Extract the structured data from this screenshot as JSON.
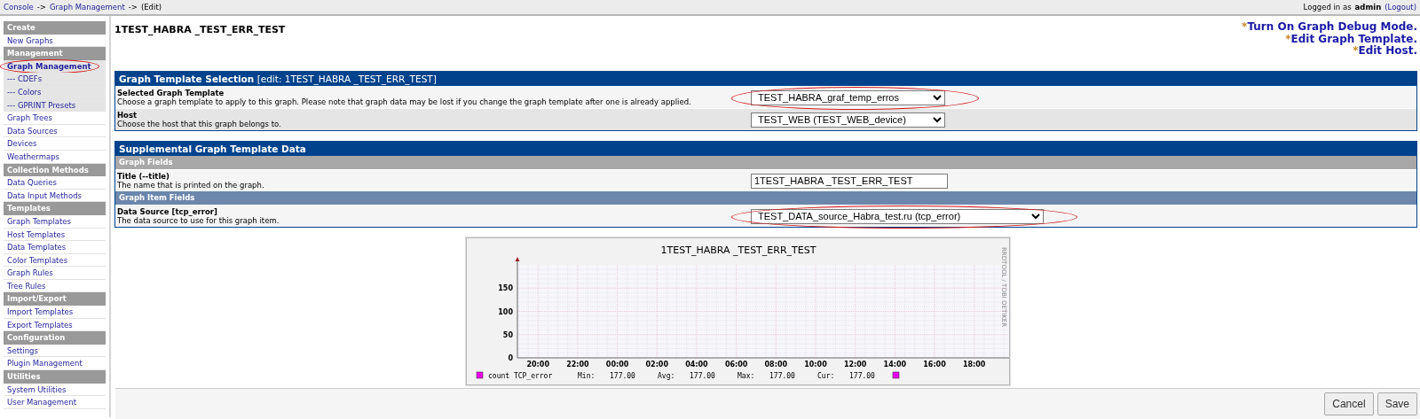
{
  "breadcrumb": {
    "links": [
      "Console",
      "Graph Management"
    ],
    "separator": "->",
    "current": "(Edit)"
  },
  "login": {
    "prefix": "Logged in as",
    "user": "admin",
    "logout": "(Logout)"
  },
  "sidebar": {
    "sections": [
      {
        "title": "Create",
        "items": [
          {
            "label": "New Graphs",
            "selected": false
          }
        ]
      },
      {
        "title": "Management",
        "items": [
          {
            "label": "Graph Management",
            "selected": true,
            "annotated": true,
            "children": [
              {
                "label": "--- CDEFs",
                "selected": false
              },
              {
                "label": "--- Colors",
                "selected": false
              },
              {
                "label": "--- GPRINT Presets",
                "selected": false
              }
            ]
          },
          {
            "label": "Graph Trees",
            "selected": false
          },
          {
            "label": "Data Sources",
            "selected": false
          },
          {
            "label": "Devices",
            "selected": false
          },
          {
            "label": "Weathermaps",
            "selected": false
          }
        ]
      },
      {
        "title": "Collection Methods",
        "items": [
          {
            "label": "Data Queries",
            "selected": false
          },
          {
            "label": "Data Input Methods",
            "selected": false
          }
        ]
      },
      {
        "title": "Templates",
        "items": [
          {
            "label": "Graph Templates",
            "selected": false
          },
          {
            "label": "Host Templates",
            "selected": false
          },
          {
            "label": "Data Templates",
            "selected": false
          },
          {
            "label": "Color Templates",
            "selected": false
          },
          {
            "label": "Graph Rules",
            "selected": false
          },
          {
            "label": "Tree Rules",
            "selected": false
          }
        ]
      },
      {
        "title": "Import/Export",
        "items": [
          {
            "label": "Import Templates",
            "selected": false
          },
          {
            "label": "Export Templates",
            "selected": false
          }
        ]
      },
      {
        "title": "Configuration",
        "items": [
          {
            "label": "Settings",
            "selected": false
          },
          {
            "label": "Plugin Management",
            "selected": false
          }
        ]
      },
      {
        "title": "Utilities",
        "items": [
          {
            "label": "System Utilities",
            "selected": false
          },
          {
            "label": "User Management",
            "selected": false
          }
        ]
      }
    ]
  },
  "page_title": "1TEST_HABRA _TEST_ERR_TEST",
  "header_links": [
    {
      "bullet": "*",
      "label": "Turn On Graph Debug Mode."
    },
    {
      "bullet": "*",
      "label": "Edit Graph Template."
    },
    {
      "bullet": "*",
      "label": "Edit Host."
    }
  ],
  "panels": [
    {
      "title": "Graph Template Selection",
      "subtitle": "[edit: 1TEST_HABRA _TEST_ERR_TEST]",
      "rows": [
        {
          "kind": "field",
          "label": "Selected Graph Template",
          "description": "Choose a graph template to apply to this graph. Please note that graph data may be lost if you change the graph template after one is already applied.",
          "control": {
            "kind": "select",
            "value": "TEST_HABRA_graf_temp_erros"
          },
          "annotated": true
        },
        {
          "kind": "field",
          "label": "Host",
          "description": "Choose the host that this graph belongs to.",
          "control": {
            "kind": "select",
            "value": "TEST_WEB (TEST_WEB_device)"
          },
          "annotated": false
        }
      ]
    },
    {
      "title": "Supplemental Graph Template Data",
      "rows": [
        {
          "kind": "section",
          "label": "Graph Fields",
          "color": "#a8a8a8"
        },
        {
          "kind": "field",
          "label": "Title (--title)",
          "description": "The name that is printed on the graph.",
          "control": {
            "kind": "text",
            "value": "1TEST_HABRA _TEST_ERR_TEST"
          },
          "annotated": false
        },
        {
          "kind": "section",
          "label": "Graph Item Fields",
          "color": "#6c87ac"
        },
        {
          "kind": "field",
          "label": "Data Source [tcp_error]",
          "description": "The data source to use for this graph item.",
          "control": {
            "kind": "select",
            "value": "TEST_DATA_source_Habra_test.ru (tcp_error)"
          },
          "annotated": true
        }
      ]
    }
  ],
  "graph": {
    "title": "1TEST_HABRA _TEST_ERR_TEST",
    "side_label": "RRDTOOL / TOBI OETIKER",
    "chart_data": {
      "type": "line",
      "categories": [
        "20:00",
        "22:00",
        "00:00",
        "02:00",
        "04:00",
        "06:00",
        "08:00",
        "10:00",
        "12:00",
        "14:00",
        "16:00",
        "18:00"
      ],
      "ylim": [
        0,
        200
      ],
      "grid": true,
      "yticks": [
        0,
        50,
        100,
        150
      ],
      "series": [
        {
          "name": "count TCP_error",
          "color": "#ff00ff",
          "values": [
            null,
            null,
            null,
            null,
            null,
            null,
            null,
            null,
            null,
            null,
            null,
            null
          ]
        }
      ]
    },
    "legend_stats": [
      {
        "name": "Min:",
        "value": "177.00"
      },
      {
        "name": "Avg:",
        "value": "177.00"
      },
      {
        "name": "Max:",
        "value": "177.00"
      },
      {
        "name": "Cur:",
        "value": "177.00"
      }
    ]
  },
  "buttons": [
    "Cancel",
    "Save"
  ]
}
